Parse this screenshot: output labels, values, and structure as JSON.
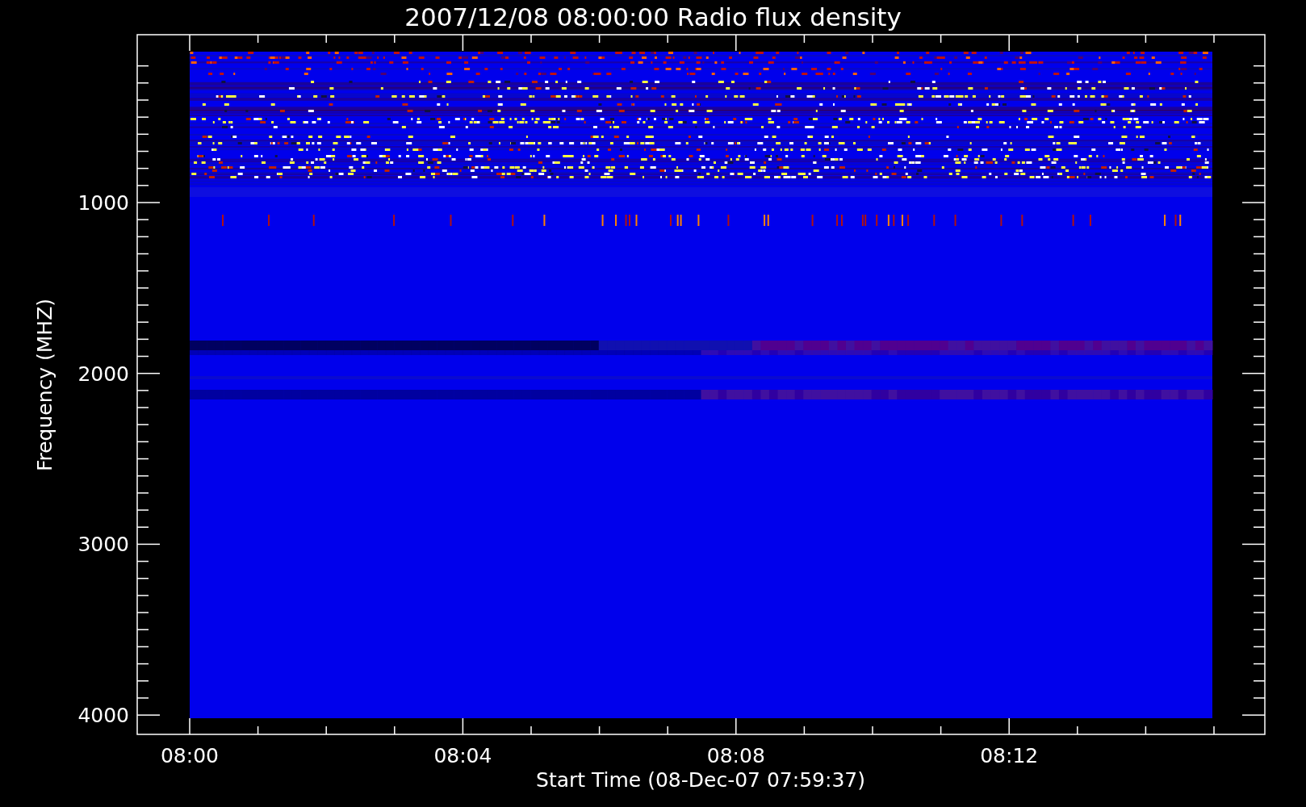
{
  "plot": {
    "title": "2007/12/08 08:00:00 Radio flux density",
    "y_axis": {
      "label": "Frequency (MHZ)",
      "tick_labels": [
        "1000",
        "2000",
        "3000",
        "4000"
      ]
    },
    "x_axis": {
      "label": "Start Time (08-Dec-07 07:59:37)",
      "tick_labels": [
        "08:00",
        "08:04",
        "08:08",
        "08:12"
      ]
    }
  }
}
